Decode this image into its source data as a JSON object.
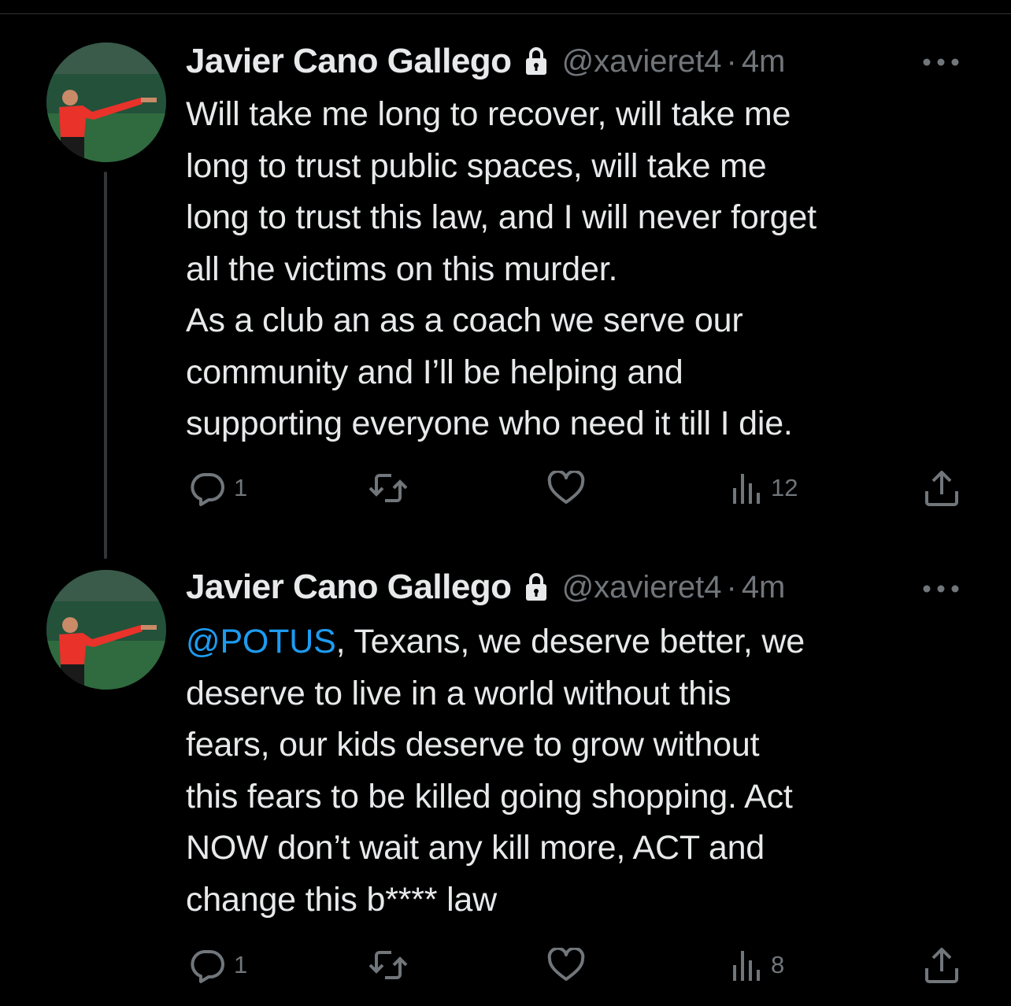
{
  "tweets": [
    {
      "display_name": "Javier Cano Gallego",
      "handle": "@xavieret4",
      "separator": "·",
      "time": "4m",
      "mention": "",
      "text": "Will take me long to recover, will take me\nlong to trust public spaces, will take me\nlong to trust this law, and I will never forget\nall the victims on this murder.\nAs a club an as a coach we serve our\ncommunity and I’ll be helping and\nsupporting everyone who need it till I die.",
      "replies": "1",
      "retweets": "",
      "likes": "",
      "views": "12"
    },
    {
      "display_name": "Javier Cano Gallego",
      "handle": "@xavieret4",
      "separator": "·",
      "time": "4m",
      "mention": "@POTUS",
      "text": ", Texans, we deserve better, we\ndeserve to live in a world without this\nfears, our kids deserve to grow without\nthis fears to be killed going shopping. Act\nNOW don’t wait any kill more, ACT and\nchange this b**** law",
      "replies": "1",
      "retweets": "",
      "likes": "",
      "views": "8"
    }
  ],
  "icons": {
    "lock": "lock-icon",
    "more": "more-icon",
    "reply": "reply-icon",
    "retweet": "retweet-icon",
    "like": "like-icon",
    "views": "views-icon",
    "share": "share-icon"
  },
  "colors": {
    "background": "#000000",
    "text": "#e7e9ea",
    "secondary": "#71767b",
    "mention": "#1d9bf0",
    "thread_line": "#333639"
  }
}
